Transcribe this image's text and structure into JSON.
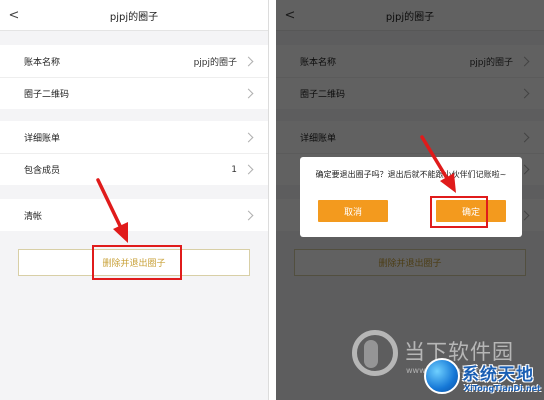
{
  "nav": {
    "back_icon": "chevron-left-icon",
    "back_glyph": "<",
    "title": "pjpj的圈子"
  },
  "settings": {
    "rows": [
      {
        "label": "账本名称",
        "value": "pjpj的圈子"
      },
      {
        "label": "圈子二维码",
        "value": ""
      },
      {
        "label": "详细账单",
        "value": ""
      },
      {
        "label": "包含成员",
        "value": "1"
      },
      {
        "label": "清帐",
        "value": ""
      }
    ],
    "exit_button": "删除并退出圈子"
  },
  "dialog": {
    "message": "确定要退出圈子吗？退出后就不能跟小伙伴们记账啦~",
    "cancel": "取消",
    "confirm": "确定"
  },
  "watermark": {
    "text": "当下软件园",
    "url": "www.downxia.com"
  },
  "brand": {
    "name": "系统天地",
    "url": "XiTongTianDi.net"
  },
  "colors": {
    "accent": "#f39a1e",
    "highlight": "#e01b1b",
    "danger_text": "#c9a23a",
    "brand": "#1a5fb4"
  }
}
